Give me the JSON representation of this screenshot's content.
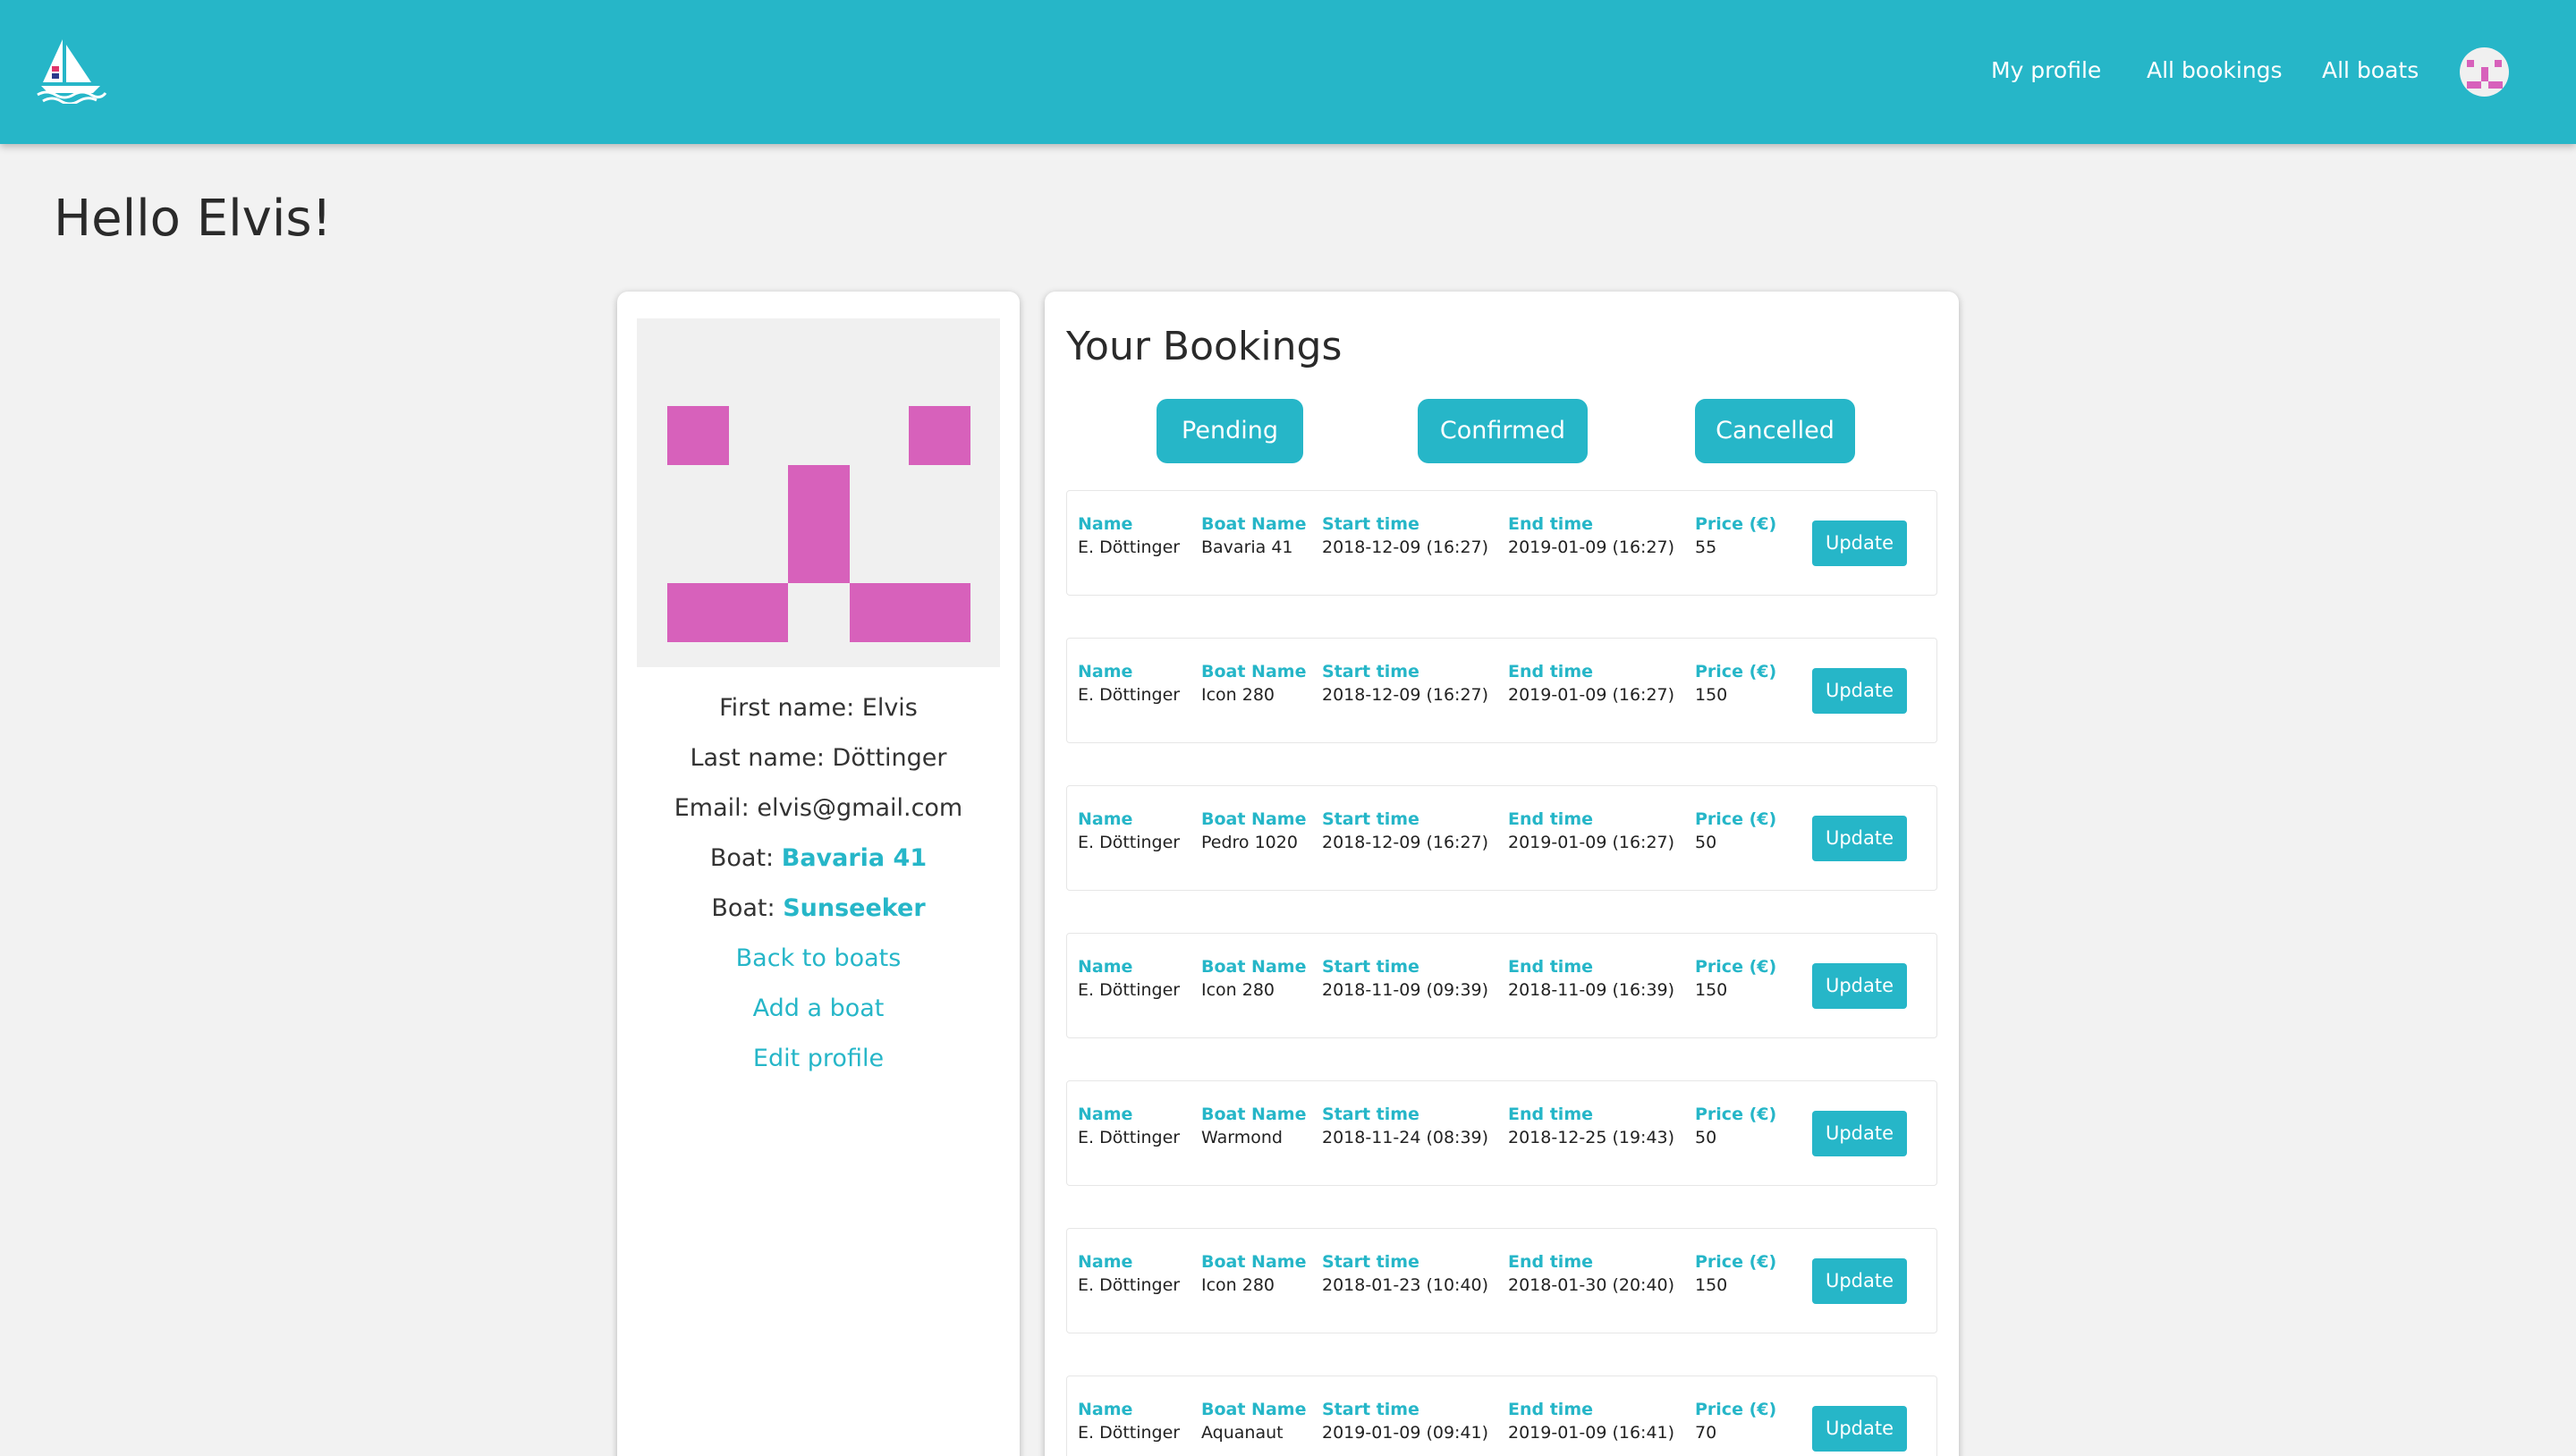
{
  "theme": {
    "accent": "#26b6c8",
    "avatar_pink": "#d761bb",
    "background": "#f2f2f2"
  },
  "header": {
    "logo_icon": "sailboat-logo-icon",
    "nav": [
      {
        "label": "My profile"
      },
      {
        "label": "All bookings"
      },
      {
        "label": "All boats"
      }
    ],
    "avatar_icon": "user-avatar-icon"
  },
  "greeting": "Hello Elvis!",
  "profile": {
    "avatar_icon": "identicon-avatar",
    "first_name": "First name: Elvis",
    "last_name": "Last name: Döttinger",
    "email": "Email: elvis@gmail.com",
    "boat_prefix": "Boat: ",
    "boats": [
      "Bavaria 41",
      "Sunseeker"
    ],
    "links": [
      "Back to boats",
      "Add a boat",
      "Edit profile"
    ]
  },
  "bookings": {
    "title": "Your Bookings",
    "filters": [
      "Pending",
      "Confirmed",
      "Cancelled"
    ],
    "labels": {
      "name": "Name",
      "boat": "Boat Name",
      "start": "Start time",
      "end": "End time",
      "price": "Price (€)"
    },
    "update_label": "Update",
    "rows": [
      {
        "name": "E. Döttinger",
        "boat": "Bavaria 41",
        "start": "2018-12-09 (16:27)",
        "end": "2019-01-09 (16:27)",
        "price": "55"
      },
      {
        "name": "E. Döttinger",
        "boat": "Icon 280",
        "start": "2018-12-09 (16:27)",
        "end": "2019-01-09 (16:27)",
        "price": "150"
      },
      {
        "name": "E. Döttinger",
        "boat": "Pedro 1020",
        "start": "2018-12-09 (16:27)",
        "end": "2019-01-09 (16:27)",
        "price": "50"
      },
      {
        "name": "E. Döttinger",
        "boat": "Icon 280",
        "start": "2018-11-09 (09:39)",
        "end": "2018-11-09 (16:39)",
        "price": "150"
      },
      {
        "name": "E. Döttinger",
        "boat": "Warmond",
        "start": "2018-11-24 (08:39)",
        "end": "2018-12-25 (19:43)",
        "price": "50"
      },
      {
        "name": "E. Döttinger",
        "boat": "Icon 280",
        "start": "2018-01-23 (10:40)",
        "end": "2018-01-30 (20:40)",
        "price": "150"
      },
      {
        "name": "E. Döttinger",
        "boat": "Aquanaut",
        "start": "2019-01-09 (09:41)",
        "end": "2019-01-09 (16:41)",
        "price": "70"
      }
    ]
  }
}
